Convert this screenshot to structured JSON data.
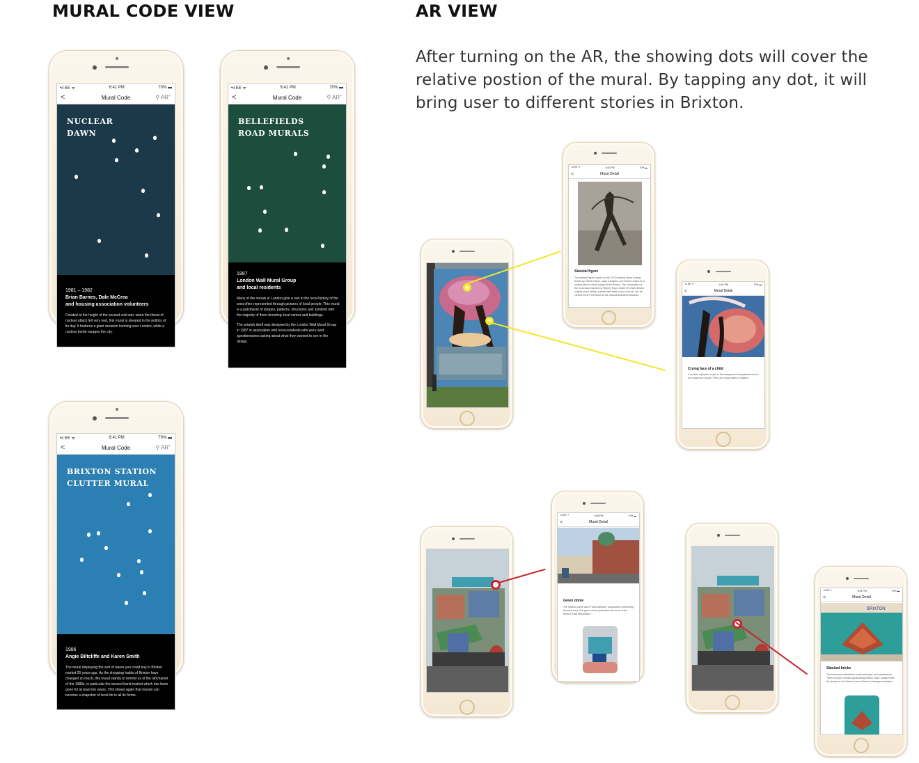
{
  "headings": {
    "mural_code": "MURAL CODE VIEW",
    "ar": "AR VIEW"
  },
  "ar_intro": "After turning on the AR, the showing dots will cover the relative postion of the mural. By tapping any dot, it will bring user to different stories in Brixton.",
  "status": {
    "carrier": "•ıl EE ᯤ",
    "time": "6:41 PM",
    "time_alt": "6:45 PM",
    "battery": "70% ▬"
  },
  "nav": {
    "back": "<",
    "code_title": "Mural Code",
    "ar_label": "AR",
    "ar_sup": "+",
    "detail_title": "Mural Detail"
  },
  "murals": [
    {
      "title_line1": "NUCLEAR",
      "title_line2": "DAWN",
      "year": "1981 – 1982",
      "artists_line1": "Brian Barnes, Dale McCrea",
      "artists_line2": "and housing association volunteers",
      "description": "Created at the height of the second cold war, when the threat of nuclear attack felt very real, this mural is steeped in the politics of its day. It features a giant skeleton looming over London, while a nuclear bomb ravages the city.",
      "color": "#1c3949"
    },
    {
      "title_line1": "BELLEFIELDS",
      "title_line2": "ROAD MURALS",
      "year": "1987",
      "artists_line1": "London Wall Mural Group",
      "artists_line2": "and local residents",
      "description": "Many of the murals in London give a nod to the local history of the area often represented through pictures of local people. This mural is a patchwork of shapes, patterns, structures and symbols with the majority of them denoting local names and buildings.",
      "description2": "The artwork itself was designed by the London Wall Mural Group in 1987 in association with local residents who were sent questionnaires asking about what they wanted to see in the design.",
      "color": "#1d4d3d"
    },
    {
      "title_line1": "BRIXTON STATION",
      "title_line2": "CLUTTER MURAL",
      "year": "1986",
      "artists_line1": "Angie Biltcliffe and Karen Smith",
      "artists_line2": "",
      "description": "The mural displaying the sort of wares you could buy in Brixton market 25 years ago. As the shopping habits of Brixton have changed so much, this mural stands to remind us of the old market of the 1980s, in particular the second hand market which has been gone for at least ten years. This shows again that murals can become a snapshot of local life in all its forms.",
      "color": "#2c7fb3"
    }
  ],
  "details": {
    "skeletal": {
      "title": "Skeletal figure",
      "text": "The skeletal figure, based on the 1973 drawing Satan Sowing Seeds by Felicien Rops, casts a shadow over South London as a nuclear pincer cloudy hangs above Brixton. The composition of the mural was inspired by Felicien Rops' Sower of Death, Brian's original mural design, painted with water colour and ink, can be viewed in the Print Room at the Victoria and Albert Museum."
    },
    "child": {
      "title": "Crying face of a child",
      "text": "A nuclear explosion erupts in the background and painted into the hot mushroom clouds. There are crying faces of children."
    },
    "dome": {
      "title": "Green dome",
      "text": "The finished piece was a \"work abstract\" composition referencing the local area. The green dome symbolises the dome of the Brixton Road McDonald's."
    },
    "bricks": {
      "title": "Stacked bricks",
      "text": "The final mural reflects the local landscape, and artefacts etc. There is a pile of bricks symbolizing Brixton Town, similar to the tile design on the Victoria Line at Brixton Underground station."
    },
    "station_sign": "BRIXTON"
  },
  "colors": {
    "yellow_callout": "#f2e62a",
    "red_callout": "#c8232e",
    "phone_gold": "#e8d2ac"
  }
}
